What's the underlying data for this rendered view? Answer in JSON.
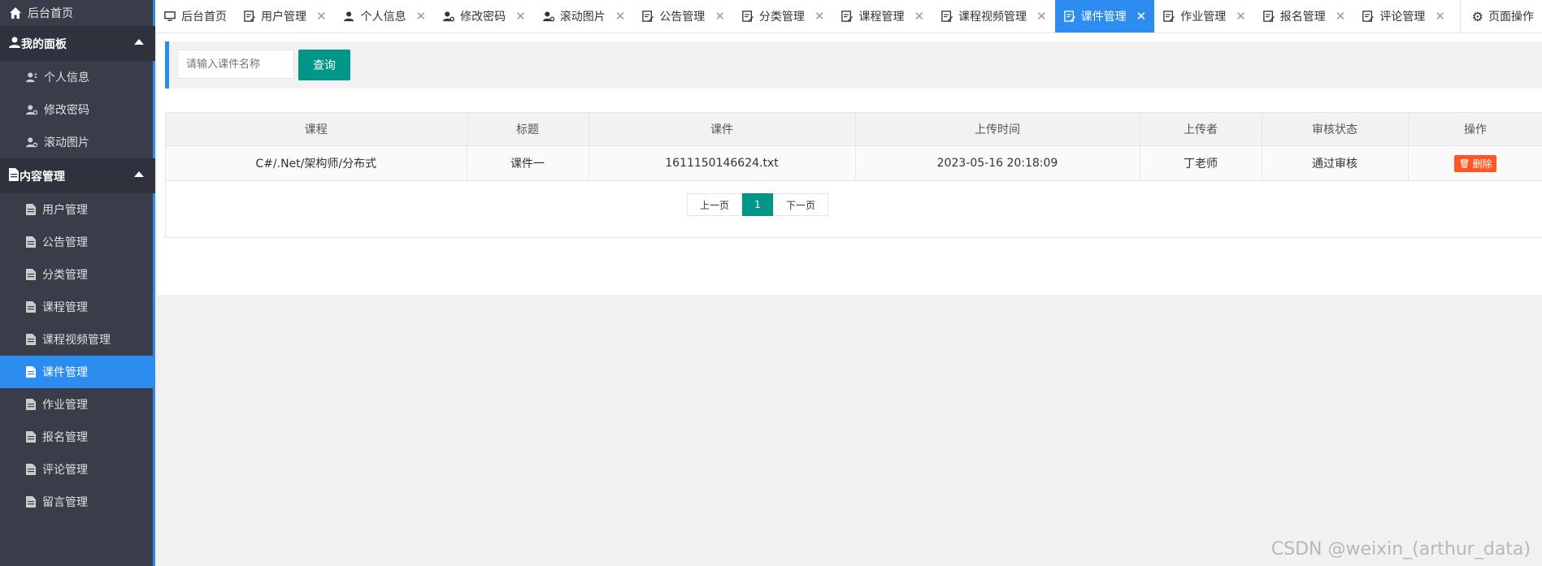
{
  "sidebar": {
    "home": "后台首页",
    "groups": [
      {
        "title": "我的面板",
        "items": [
          "个人信息",
          "修改密码",
          "滚动图片"
        ]
      },
      {
        "title": "内容管理",
        "items": [
          "用户管理",
          "公告管理",
          "分类管理",
          "课程管理",
          "课程视频管理",
          "课件管理",
          "作业管理",
          "报名管理",
          "评论管理",
          "留言管理"
        ]
      }
    ],
    "active_item": "课件管理"
  },
  "tabs": [
    {
      "label": "后台首页",
      "icon": "monitor-icon",
      "closable": false
    },
    {
      "label": "用户管理",
      "icon": "edit-icon",
      "closable": true
    },
    {
      "label": "个人信息",
      "icon": "user-icon",
      "closable": true
    },
    {
      "label": "修改密码",
      "icon": "user-key-icon",
      "closable": true
    },
    {
      "label": "滚动图片",
      "icon": "user-key-icon",
      "closable": true
    },
    {
      "label": "公告管理",
      "icon": "edit-icon",
      "closable": true
    },
    {
      "label": "分类管理",
      "icon": "edit-icon",
      "closable": true
    },
    {
      "label": "课程管理",
      "icon": "edit-icon",
      "closable": true
    },
    {
      "label": "课程视频管理",
      "icon": "edit-icon",
      "closable": true
    },
    {
      "label": "课件管理",
      "icon": "edit-icon",
      "closable": true,
      "active": true
    },
    {
      "label": "作业管理",
      "icon": "edit-icon",
      "closable": true
    },
    {
      "label": "报名管理",
      "icon": "edit-icon",
      "closable": true
    },
    {
      "label": "评论管理",
      "icon": "edit-icon",
      "closable": true
    }
  ],
  "page_ops": "页面操作",
  "search": {
    "placeholder": "请输入课件名称",
    "button": "查询"
  },
  "table": {
    "headers": [
      "课程",
      "标题",
      "课件",
      "上传时间",
      "上传者",
      "审核状态",
      "操作"
    ],
    "rows": [
      [
        "C#/.Net/架构师/分布式",
        "课件一",
        "1611150146624.txt",
        "2023-05-16 20:18:09",
        "丁老师",
        "通过审核",
        "删除"
      ]
    ]
  },
  "pager": {
    "prev": "上一页",
    "current": "1",
    "next": "下一页"
  },
  "watermark": "CSDN @weixin_(arthur_data)",
  "colors": {
    "sidebar_bg": "#393d49",
    "accent_blue": "#2d8cf0",
    "teal": "#009688",
    "danger": "#ff5722"
  }
}
